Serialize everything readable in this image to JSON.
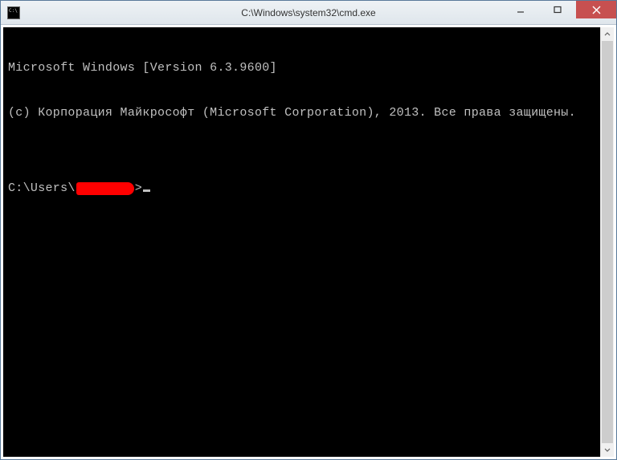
{
  "window": {
    "title": "C:\\Windows\\system32\\cmd.exe"
  },
  "console": {
    "line1": "Microsoft Windows [Version 6.3.9600]",
    "line2": "(c) Корпорация Майкрософт (Microsoft Corporation), 2013. Все права защищены.",
    "blank": "",
    "prompt_prefix": "C:\\Users\\",
    "prompt_suffix": ">"
  }
}
